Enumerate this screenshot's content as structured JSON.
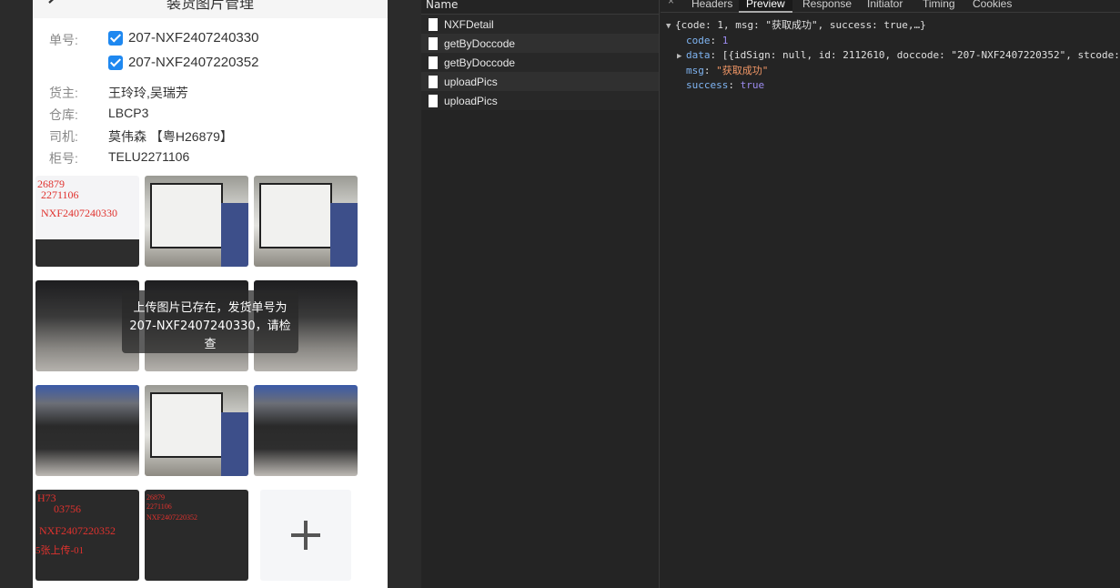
{
  "mobile": {
    "title": "装货图片管理",
    "order_label": "单号:",
    "orders": [
      "207-NXF2407240330",
      "207-NXF2407220352"
    ],
    "owner_label": "货主:",
    "owner_value": "王玲玲,吴瑞芳",
    "warehouse_label": "仓库:",
    "warehouse_value": "LBCP3",
    "driver_label": "司机:",
    "driver_value": "莫伟森 【粤H26879】",
    "cabinet_label": "柜号:",
    "cabinet_value": "TELU2271106",
    "photo1_text": [
      "26879",
      "2271106",
      "NXF2407240330"
    ],
    "photo10_text": [
      "H73",
      "03756",
      "NXF2407220352",
      "5张上传-01"
    ],
    "photo11_text": [
      "26879",
      "2271106",
      "NXF2407220352"
    ],
    "toast": "上传图片已存在，发货单号为207-NXF2407240330，请检查",
    "add_symbol": "+"
  },
  "network": {
    "header": "Name",
    "rows": [
      "NXFDetail",
      "getByDoccode",
      "getByDoccode",
      "uploadPics",
      "uploadPics"
    ]
  },
  "preview": {
    "close": "×",
    "tabs": [
      "Headers",
      "Preview",
      "Response",
      "Initiator",
      "Timing",
      "Cookies"
    ],
    "active_tab": "Preview",
    "line1": "{code: 1, msg: \"获取成功\", success: true,…}",
    "code_key": "code",
    "code_val": "1",
    "data_key": "data",
    "data_val": "[{idSign: null, id: 2112610, doccode: \"207-NXF2407220352\", stcode:",
    "msg_key": "msg",
    "msg_val": "\"获取成功\"",
    "success_key": "success",
    "success_val": "true"
  }
}
